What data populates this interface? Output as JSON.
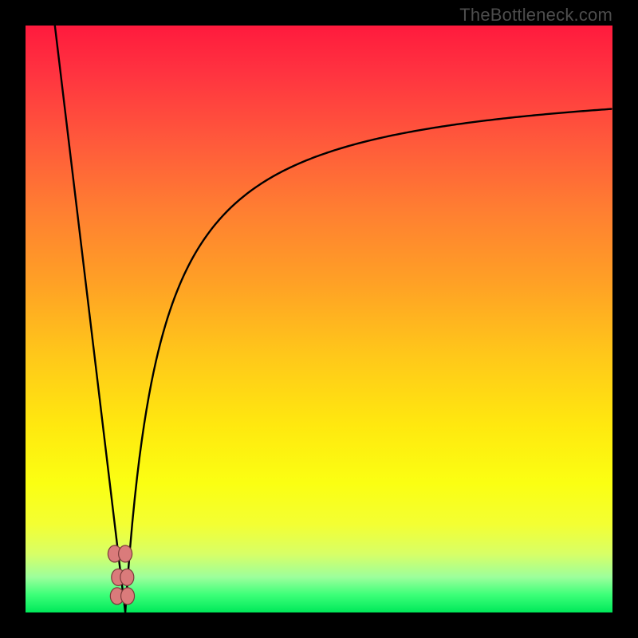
{
  "watermark": "TheBottleneck.com",
  "colors": {
    "frame": "#000000",
    "curve": "#000000",
    "point_fill": "#da7b7b",
    "point_stroke": "#7a3a3a",
    "gradient_top": "#ff1a3d",
    "gradient_bottom": "#00e85a"
  },
  "chart_data": {
    "type": "line",
    "title": "",
    "xlabel": "",
    "ylabel": "",
    "ylim": [
      0,
      100
    ],
    "xlim": [
      0,
      100
    ],
    "curve_note": "V-shaped bottleneck curve: falls from 100% at x≈5 to 0% at x≈17, then rises asymptotically toward ~90% by x=100. y interpreted as bottleneck percentage (top=high bottleneck, bottom=0%).",
    "series": [
      {
        "name": "bottleneck-curve",
        "x": [
          5,
          8,
          11,
          14,
          16,
          17,
          18,
          20,
          23,
          27,
          32,
          38,
          46,
          56,
          68,
          82,
          100
        ],
        "y": [
          100,
          75,
          50,
          25,
          10,
          0,
          8,
          22,
          37,
          50,
          60,
          68,
          75,
          80,
          84,
          87,
          90
        ]
      }
    ],
    "points": [
      {
        "x": 15.2,
        "y": 10.0
      },
      {
        "x": 17.0,
        "y": 10.0
      },
      {
        "x": 15.8,
        "y": 6.0
      },
      {
        "x": 17.3,
        "y": 6.0
      },
      {
        "x": 15.6,
        "y": 2.8
      },
      {
        "x": 17.4,
        "y": 2.8
      }
    ]
  }
}
